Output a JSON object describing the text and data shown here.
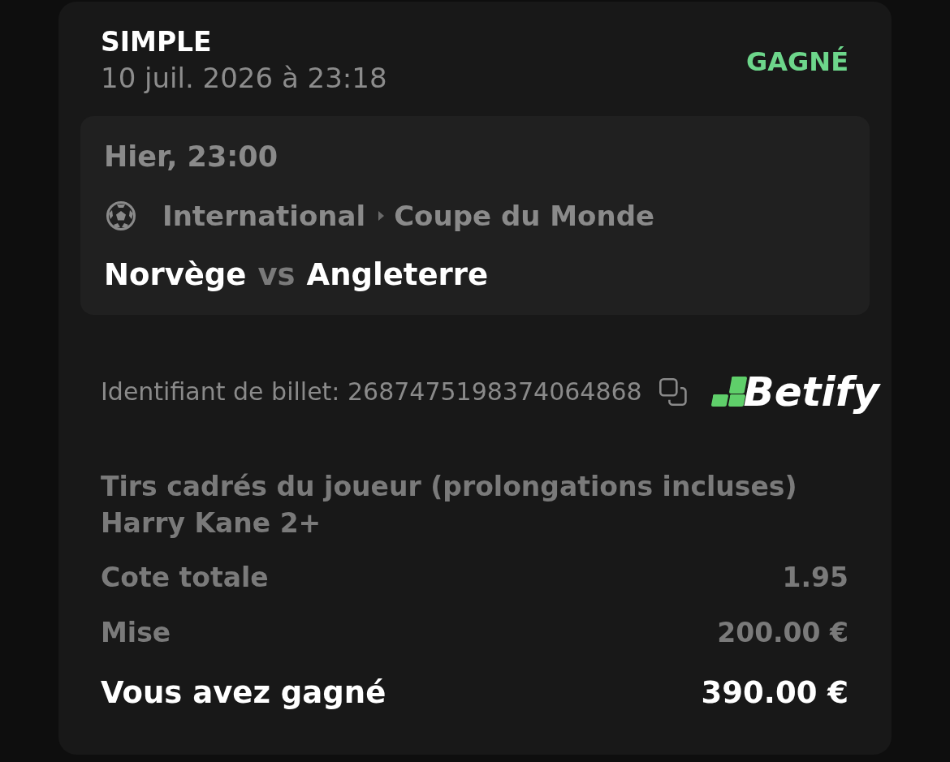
{
  "bet": {
    "type": "SIMPLE",
    "placed_at": "10 juil. 2026 à 23:18",
    "status": {
      "label": "GAGNÉ",
      "kind": "won"
    }
  },
  "event": {
    "time": "Hier, 23:00",
    "breadcrumb": [
      "International",
      "Coupe du Monde"
    ],
    "home": "Norvège",
    "separator": "vs",
    "away": "Angleterre"
  },
  "ticket": {
    "label": "Identifiant de billet: 2687475198374064868",
    "brand": "Betify"
  },
  "selection": {
    "market": "Tirs cadrés du joueur (prolongations incluses)",
    "pick": "Harry Kane 2+"
  },
  "summary": [
    {
      "label": "Cote totale",
      "value": "1.95",
      "kind": "normal"
    },
    {
      "label": "Mise",
      "value": "200.00 €",
      "kind": "normal"
    },
    {
      "label": "Vous avez gagné",
      "value": "390.00 €",
      "kind": "total"
    }
  ]
}
